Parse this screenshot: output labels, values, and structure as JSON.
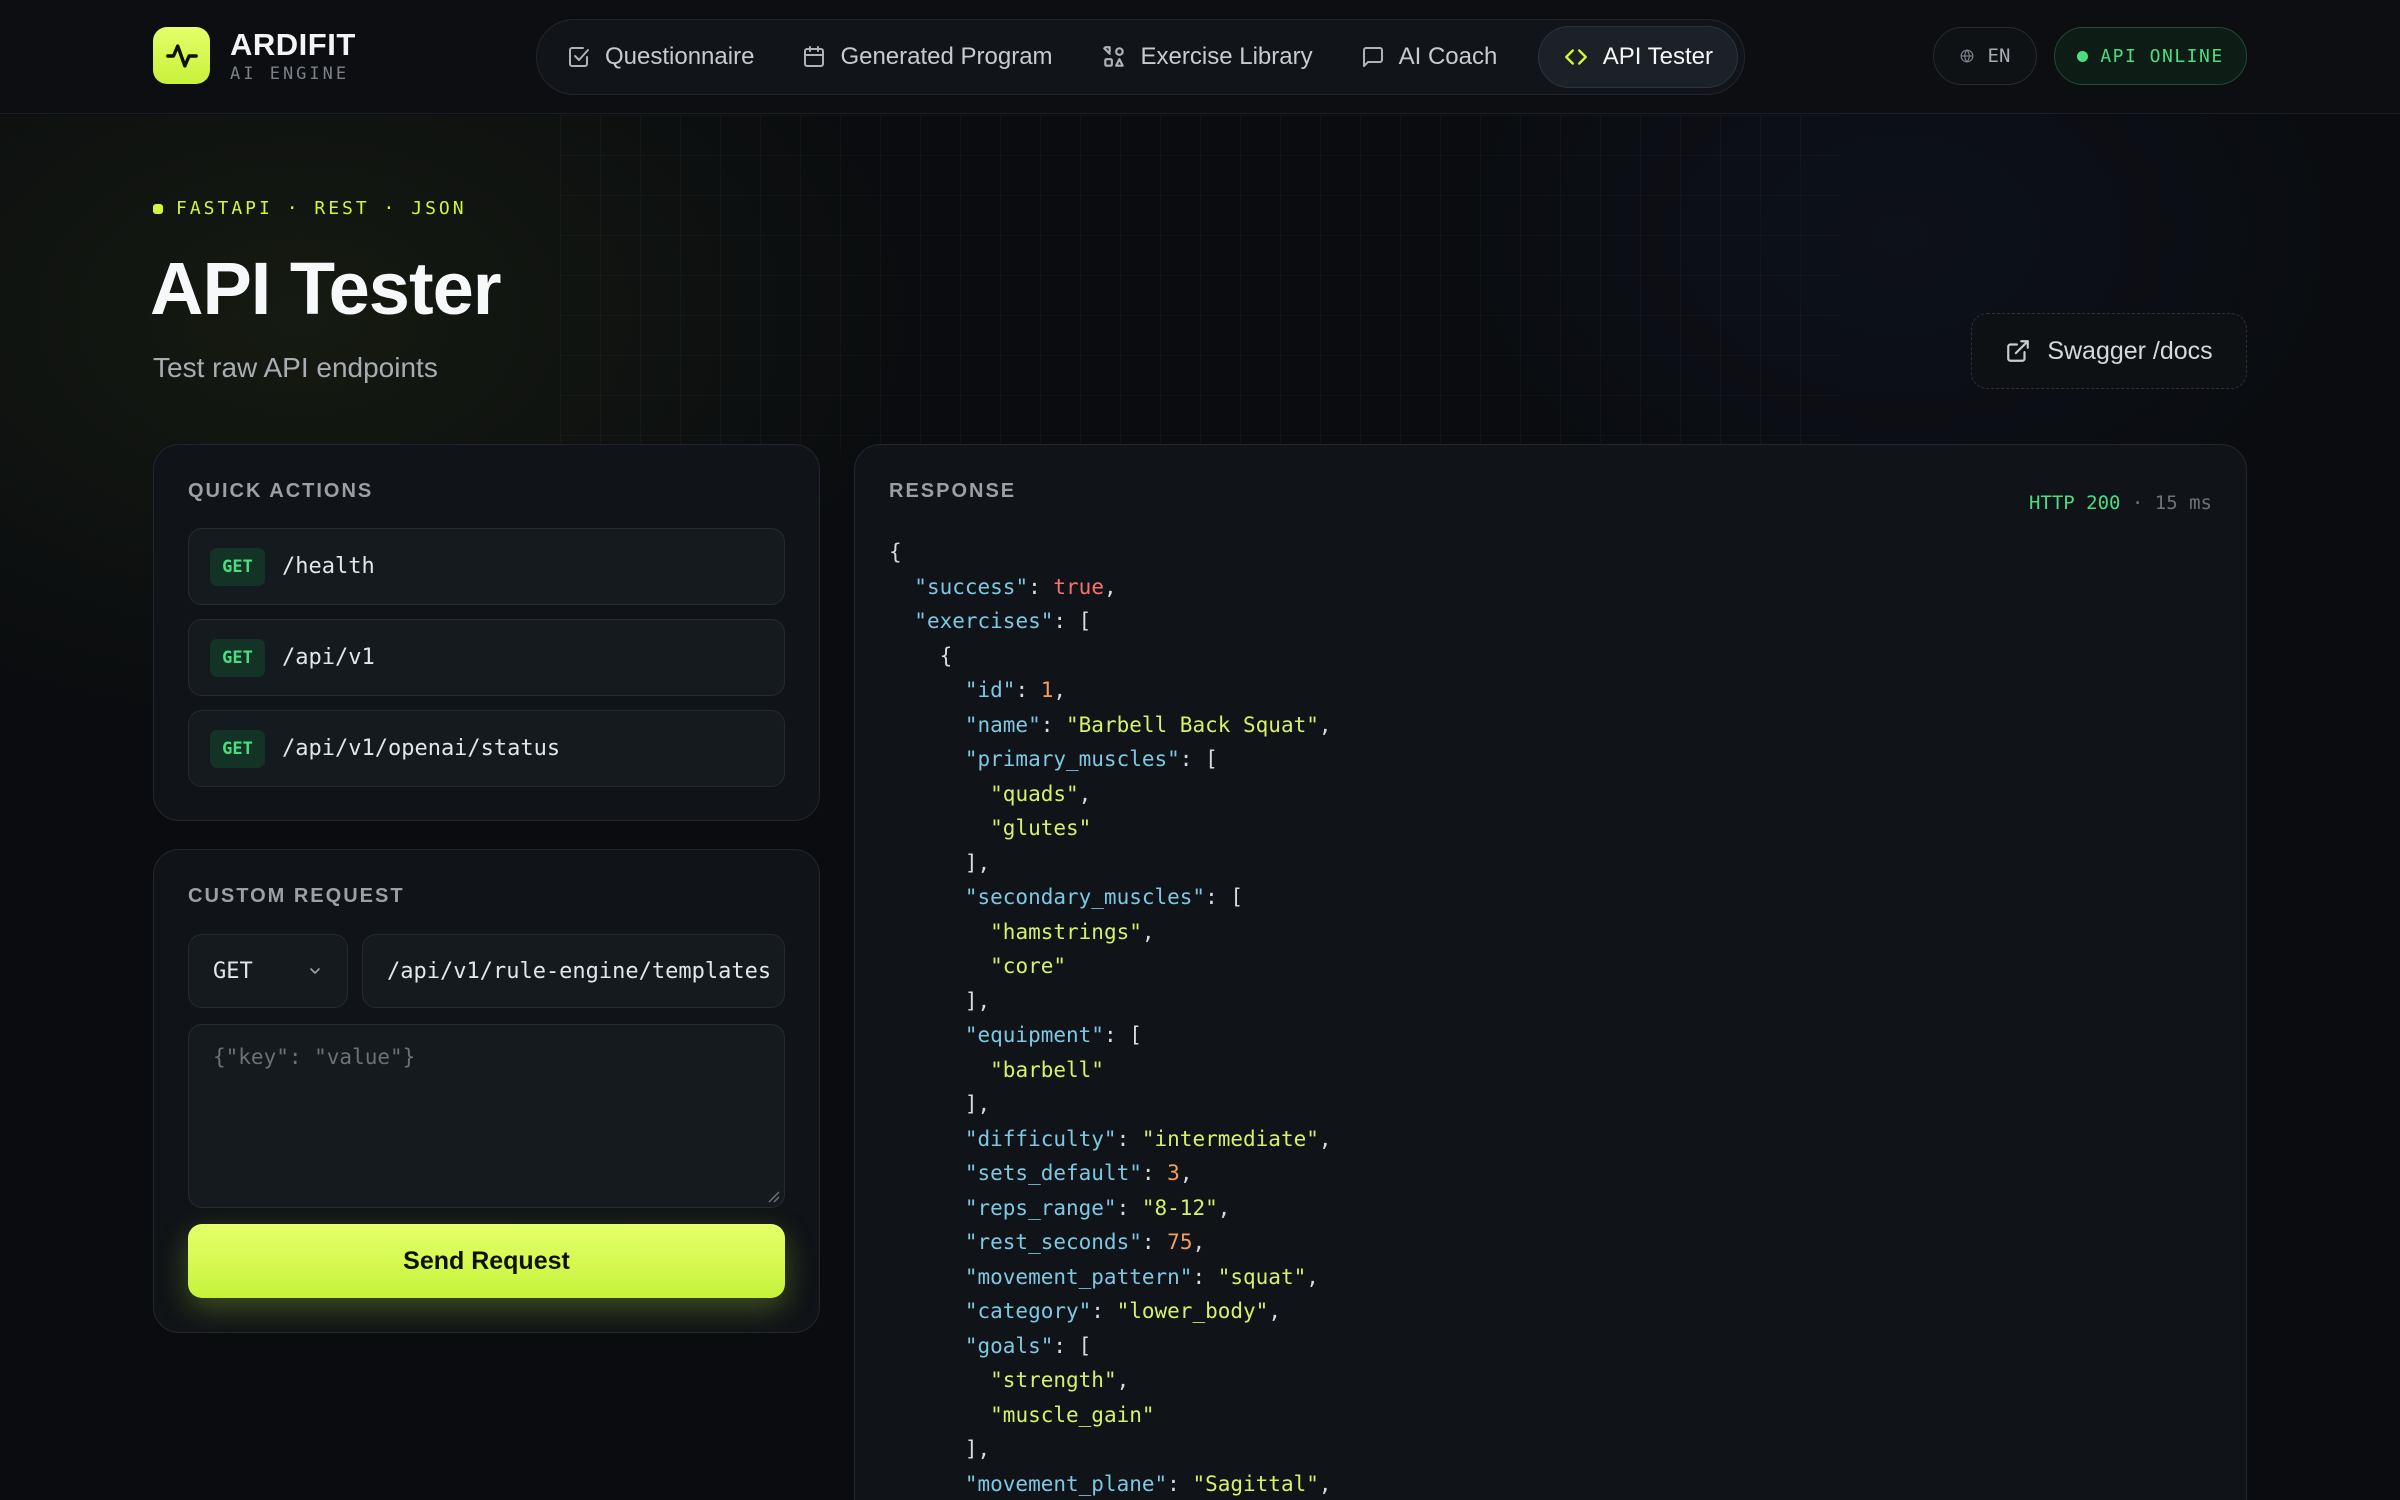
{
  "brand": {
    "name": "ARDIFIT",
    "subtitle": "AI ENGINE"
  },
  "nav": {
    "items": [
      {
        "label": "Questionnaire",
        "icon": "checkbox-icon"
      },
      {
        "label": "Generated Program",
        "icon": "calendar-icon"
      },
      {
        "label": "Exercise Library",
        "icon": "shapes-icon"
      },
      {
        "label": "AI Coach",
        "icon": "chat-icon"
      },
      {
        "label": "API Tester",
        "icon": "code-icon",
        "active": true
      }
    ]
  },
  "header": {
    "language": "EN",
    "api_status": "API ONLINE"
  },
  "hero": {
    "eyebrow": "FASTAPI · REST · JSON",
    "title": "API Tester",
    "subtitle": "Test raw API endpoints",
    "swagger_label": "Swagger /docs"
  },
  "quick_actions": {
    "label": "QUICK ACTIONS",
    "items": [
      {
        "method": "GET",
        "path": "/health"
      },
      {
        "method": "GET",
        "path": "/api/v1"
      },
      {
        "method": "GET",
        "path": "/api/v1/openai/status"
      }
    ]
  },
  "custom_request": {
    "label": "CUSTOM REQUEST",
    "method": "GET",
    "url": "/api/v1/rule-engine/templates",
    "body_placeholder": "{\"key\": \"value\"}",
    "send_label": "Send Request"
  },
  "response": {
    "label": "RESPONSE",
    "status_code": "HTTP 200",
    "separator": " · ",
    "duration": "15 ms",
    "json_lines": [
      [
        [
          "p",
          "{"
        ]
      ],
      [
        [
          "p",
          "  "
        ],
        [
          "k",
          "\"success\""
        ],
        [
          "p",
          ": "
        ],
        [
          "b",
          "true"
        ],
        [
          "p",
          ","
        ]
      ],
      [
        [
          "p",
          "  "
        ],
        [
          "k",
          "\"exercises\""
        ],
        [
          "p",
          ": ["
        ]
      ],
      [
        [
          "p",
          "    {"
        ]
      ],
      [
        [
          "p",
          "      "
        ],
        [
          "k",
          "\"id\""
        ],
        [
          "p",
          ": "
        ],
        [
          "n",
          "1"
        ],
        [
          "p",
          ","
        ]
      ],
      [
        [
          "p",
          "      "
        ],
        [
          "k",
          "\"name\""
        ],
        [
          "p",
          ": "
        ],
        [
          "s",
          "\"Barbell Back Squat\""
        ],
        [
          "p",
          ","
        ]
      ],
      [
        [
          "p",
          "      "
        ],
        [
          "k",
          "\"primary_muscles\""
        ],
        [
          "p",
          ": ["
        ]
      ],
      [
        [
          "p",
          "        "
        ],
        [
          "s",
          "\"quads\""
        ],
        [
          "p",
          ","
        ]
      ],
      [
        [
          "p",
          "        "
        ],
        [
          "s",
          "\"glutes\""
        ]
      ],
      [
        [
          "p",
          "      ],"
        ]
      ],
      [
        [
          "p",
          "      "
        ],
        [
          "k",
          "\"secondary_muscles\""
        ],
        [
          "p",
          ": ["
        ]
      ],
      [
        [
          "p",
          "        "
        ],
        [
          "s",
          "\"hamstrings\""
        ],
        [
          "p",
          ","
        ]
      ],
      [
        [
          "p",
          "        "
        ],
        [
          "s",
          "\"core\""
        ]
      ],
      [
        [
          "p",
          "      ],"
        ]
      ],
      [
        [
          "p",
          "      "
        ],
        [
          "k",
          "\"equipment\""
        ],
        [
          "p",
          ": ["
        ]
      ],
      [
        [
          "p",
          "        "
        ],
        [
          "s",
          "\"barbell\""
        ]
      ],
      [
        [
          "p",
          "      ],"
        ]
      ],
      [
        [
          "p",
          "      "
        ],
        [
          "k",
          "\"difficulty\""
        ],
        [
          "p",
          ": "
        ],
        [
          "s",
          "\"intermediate\""
        ],
        [
          "p",
          ","
        ]
      ],
      [
        [
          "p",
          "      "
        ],
        [
          "k",
          "\"sets_default\""
        ],
        [
          "p",
          ": "
        ],
        [
          "n",
          "3"
        ],
        [
          "p",
          ","
        ]
      ],
      [
        [
          "p",
          "      "
        ],
        [
          "k",
          "\"reps_range\""
        ],
        [
          "p",
          ": "
        ],
        [
          "s",
          "\"8-12\""
        ],
        [
          "p",
          ","
        ]
      ],
      [
        [
          "p",
          "      "
        ],
        [
          "k",
          "\"rest_seconds\""
        ],
        [
          "p",
          ": "
        ],
        [
          "n",
          "75"
        ],
        [
          "p",
          ","
        ]
      ],
      [
        [
          "p",
          "      "
        ],
        [
          "k",
          "\"movement_pattern\""
        ],
        [
          "p",
          ": "
        ],
        [
          "s",
          "\"squat\""
        ],
        [
          "p",
          ","
        ]
      ],
      [
        [
          "p",
          "      "
        ],
        [
          "k",
          "\"category\""
        ],
        [
          "p",
          ": "
        ],
        [
          "s",
          "\"lower_body\""
        ],
        [
          "p",
          ","
        ]
      ],
      [
        [
          "p",
          "      "
        ],
        [
          "k",
          "\"goals\""
        ],
        [
          "p",
          ": ["
        ]
      ],
      [
        [
          "p",
          "        "
        ],
        [
          "s",
          "\"strength\""
        ],
        [
          "p",
          ","
        ]
      ],
      [
        [
          "p",
          "        "
        ],
        [
          "s",
          "\"muscle_gain\""
        ]
      ],
      [
        [
          "p",
          "      ],"
        ]
      ],
      [
        [
          "p",
          "      "
        ],
        [
          "k",
          "\"movement_plane\""
        ],
        [
          "p",
          ": "
        ],
        [
          "s",
          "\"Sagittal\""
        ],
        [
          "p",
          ","
        ]
      ]
    ]
  },
  "colors": {
    "accent": "#d4f53a",
    "success": "#4ade80",
    "background": "#0a0c0f",
    "json_key": "#7ec8e3",
    "json_string": "#d9f06a",
    "json_number": "#f59e5b",
    "json_bool": "#f87171"
  }
}
